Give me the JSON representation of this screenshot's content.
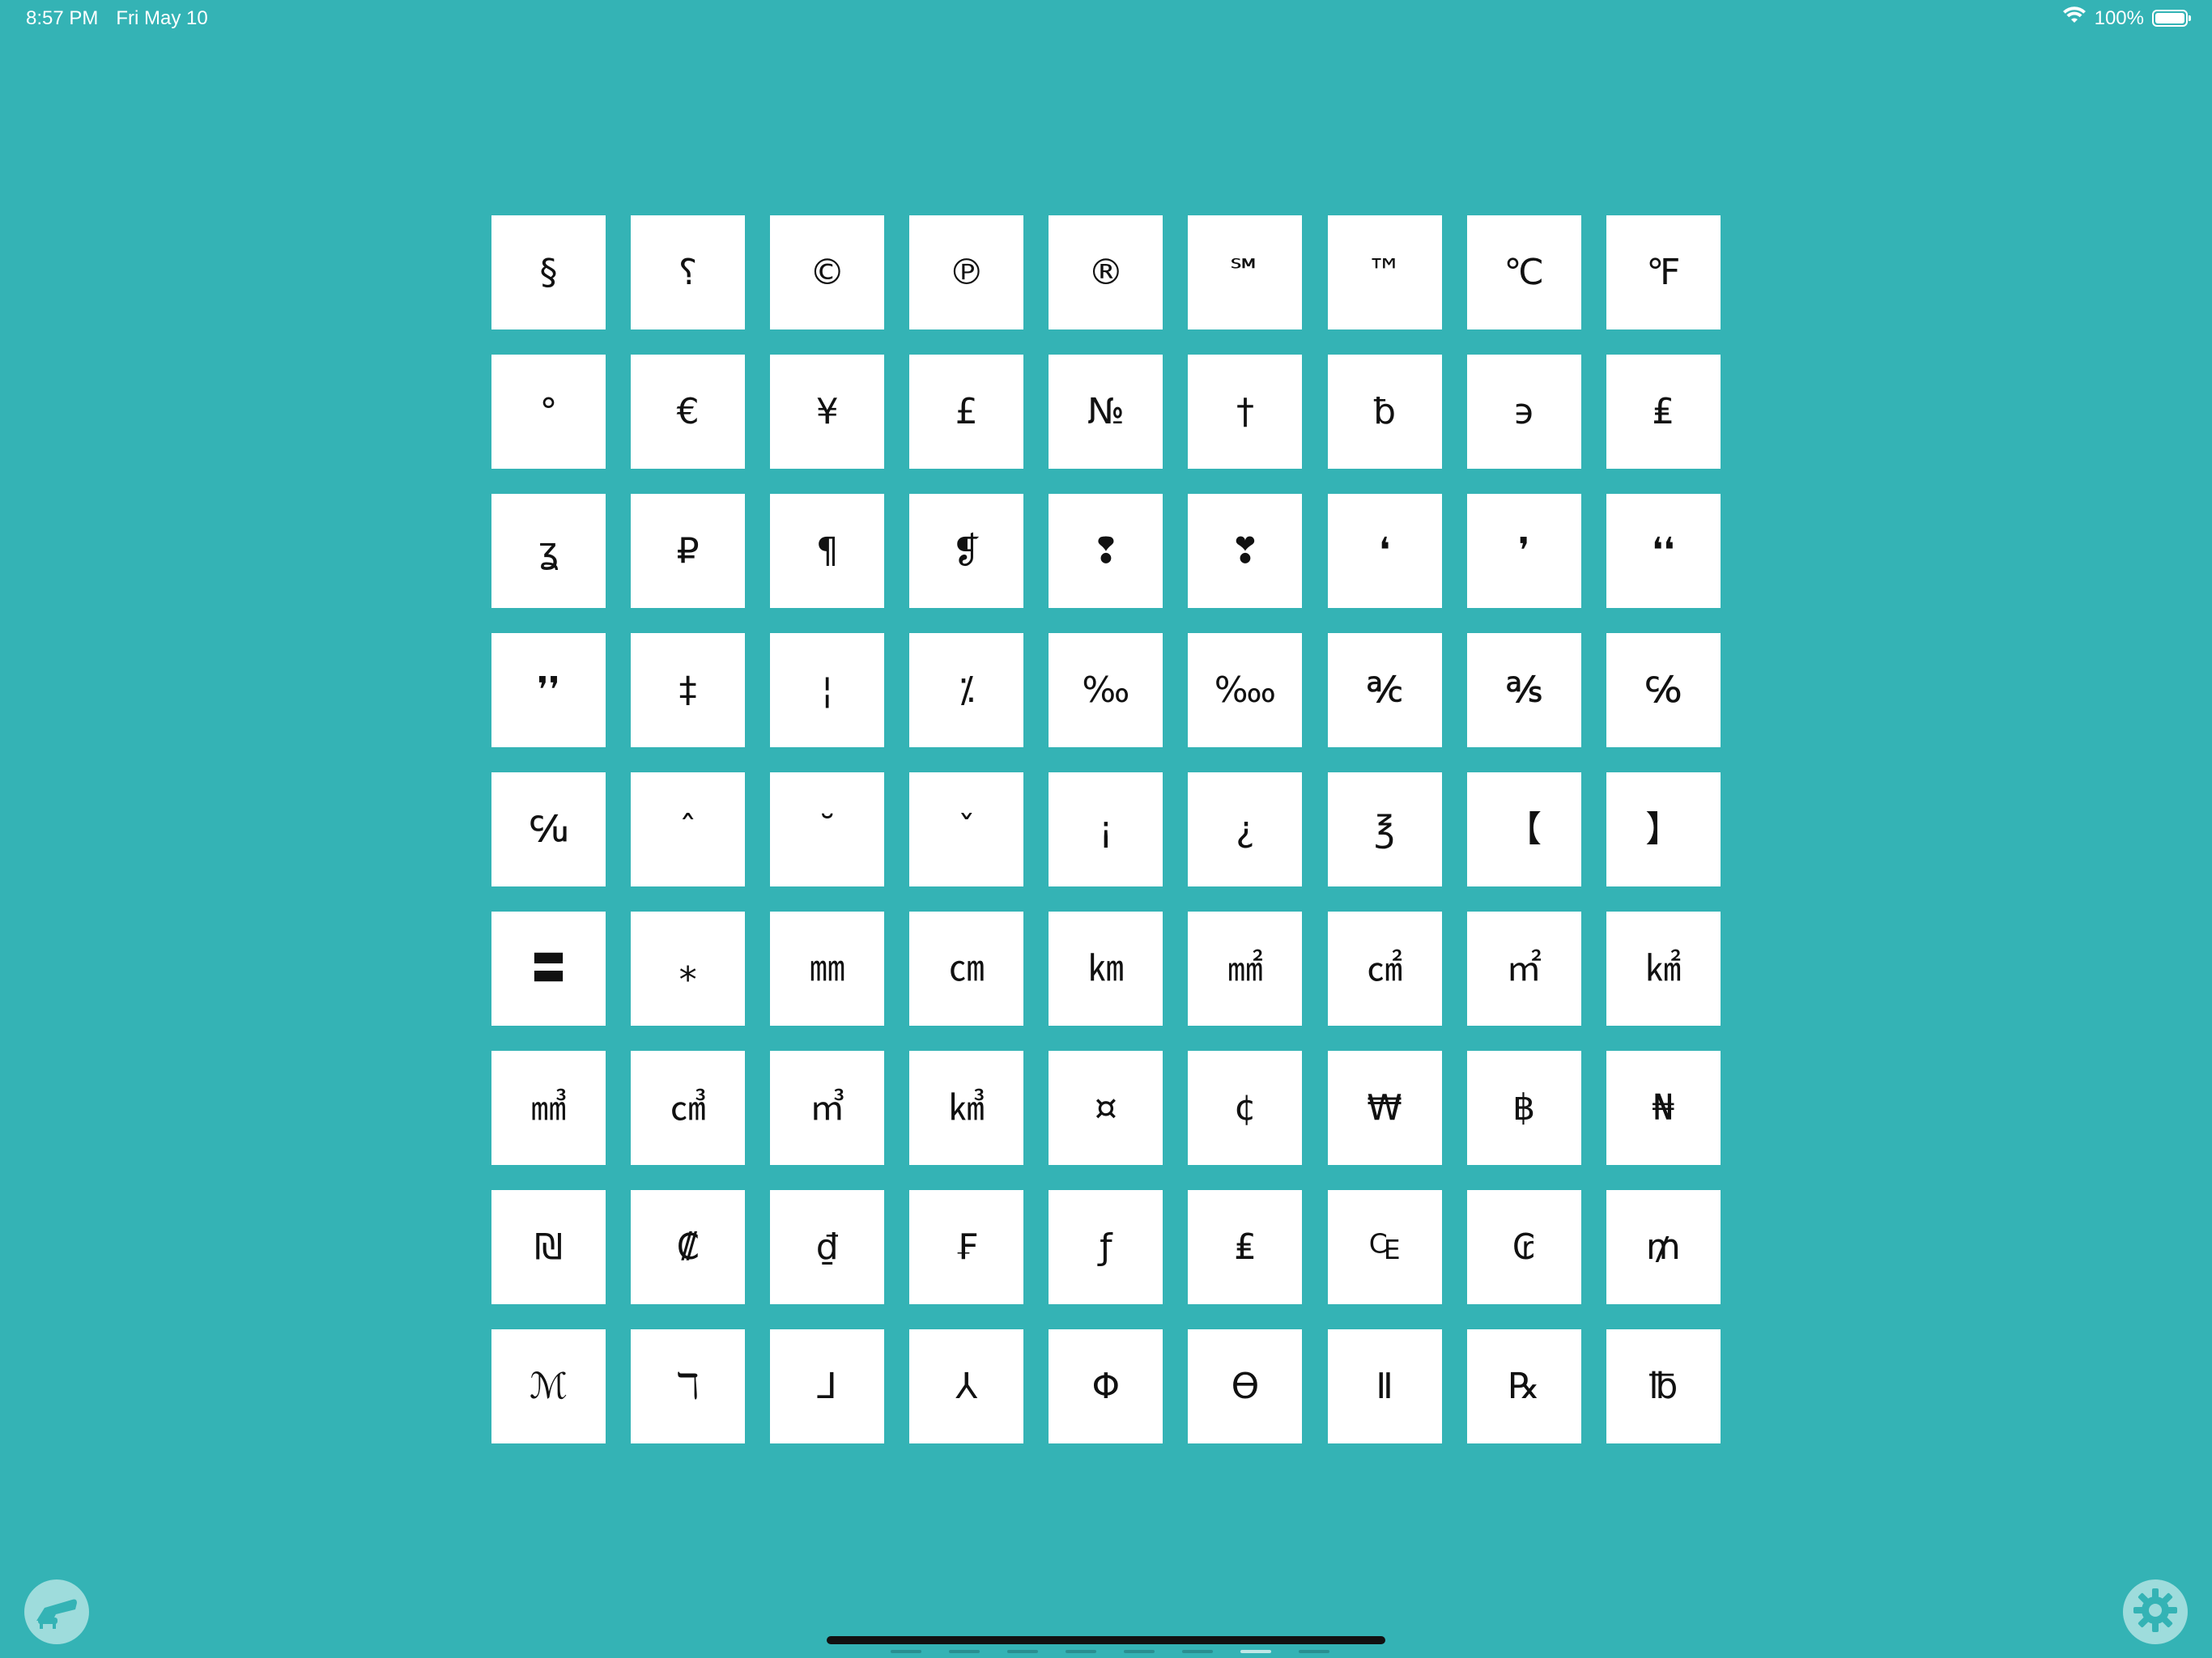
{
  "status_bar": {
    "time": "8:57 PM",
    "date": "Fri May 10",
    "battery": "100%"
  },
  "symbols": [
    "§",
    "⸮",
    "©",
    "℗",
    "®",
    "℠",
    "™",
    "℃",
    "℉",
    "°",
    "€",
    "¥",
    "£",
    "№",
    "†",
    "ƀ",
    "϶",
    "₤",
    "ʓ",
    "₽",
    "¶",
    "❡",
    "❢",
    "❣",
    "❛",
    "❜",
    "❛❛",
    "❜❜",
    "‡",
    "¦",
    "⁒",
    "‰",
    "‱",
    "℀",
    "℁",
    "℅",
    "℆",
    "ˆ",
    "˘",
    "ˇ",
    "¡",
    "¿",
    "℥",
    "【",
    "】",
    "〓",
    "⁎",
    "㎜",
    "㎝",
    "㎞",
    "㎟",
    "㎠",
    "㎡",
    "㎢",
    "㎣",
    "㎤",
    "㎥",
    "㎦",
    "¤",
    "¢",
    "₩",
    "฿",
    "₦",
    "₪",
    "₡",
    "₫",
    "₣",
    "ƒ",
    "₤",
    "₠",
    "₢",
    "₥",
    "ℳ",
    "ℸ",
    "⅃",
    "⅄",
    "Φ",
    "ϴ",
    "Ⅱ",
    "℞",
    "℔"
  ],
  "colors": {
    "background": "#34B3B5",
    "tile": "#FFFFFF",
    "button": "#9EDCDC"
  },
  "icons": {
    "left_button": "chair-icon",
    "right_button": "gear-icon"
  },
  "pager": {
    "count": 8,
    "active": 6
  }
}
